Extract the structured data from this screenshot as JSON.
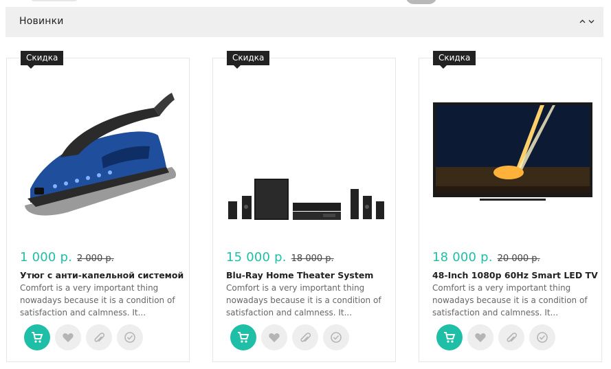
{
  "section": {
    "title": "Новинки",
    "arrow_up_icon": "chevron-up-icon",
    "arrow_down_icon": "chevron-down-icon"
  },
  "products": [
    {
      "badge": "Скидка",
      "image_icon": "steam-iron-image",
      "price_new": "1 000 р.",
      "price_old": "2 000 р.",
      "title": "Утюг с анти-капельной системой",
      "description": "Comfort is a very important thing nowadays because it is a condition of satisfaction and calmness. It..."
    },
    {
      "badge": "Скидка",
      "image_icon": "home-theater-image",
      "price_new": "15 000 р.",
      "price_old": "18 000 р.",
      "title": "Blu-Ray Home Theater System",
      "description": "Comfort is a very important thing nowadays because it is a condition of satisfaction and calmness. It..."
    },
    {
      "badge": "Скидка",
      "image_icon": "smart-tv-image",
      "price_new": "18 000 р.",
      "price_old": "20 000 р.",
      "title": "48-Inch 1080p 60Hz Smart LED TV",
      "description": "Comfort is a very important thing nowadays because it is a condition of satisfaction and calmness. It..."
    }
  ],
  "actions": [
    "cart-icon",
    "heart-icon",
    "paperclip-icon",
    "check-circle-icon"
  ],
  "colors": {
    "accent": "#1fbfa7",
    "badge_bg": "#222222",
    "header_bg": "#efefef",
    "button_bg": "#eeeeee"
  }
}
